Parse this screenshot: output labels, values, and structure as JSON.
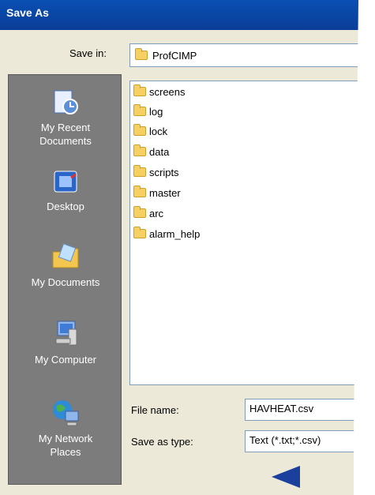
{
  "title": "Save As",
  "save_in": {
    "label": "Save in:",
    "value": "ProfCIMP",
    "icon": "folder-icon"
  },
  "places": [
    {
      "label": "My Recent\nDocuments",
      "icon": "recent-documents-icon"
    },
    {
      "label": "Desktop",
      "icon": "desktop-icon"
    },
    {
      "label": "My Documents",
      "icon": "my-documents-icon"
    },
    {
      "label": "My Computer",
      "icon": "my-computer-icon"
    },
    {
      "label": "My Network\nPlaces",
      "icon": "network-places-icon"
    }
  ],
  "files": [
    "screens",
    "log",
    "lock",
    "data",
    "scripts",
    "master",
    "arc",
    "alarm_help"
  ],
  "file_name": {
    "label": "File name:",
    "value": "HAVHEAT.csv"
  },
  "save_as_type": {
    "label": "Save as type:",
    "value": "Text (*.txt;*.csv)"
  },
  "colors": {
    "titlebar": "#0a46a8",
    "places_bar": "#7c7c7c",
    "pointer": "#1b3f9c"
  }
}
